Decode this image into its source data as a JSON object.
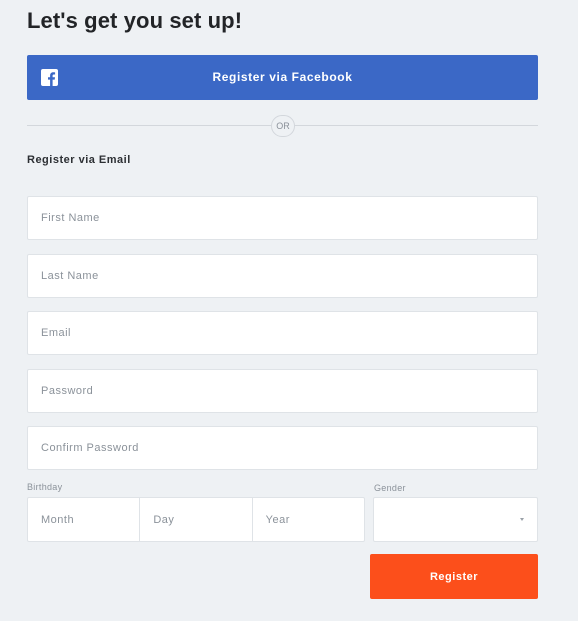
{
  "page": {
    "title": "Let's get you set up!"
  },
  "facebook": {
    "label": "Register via Facebook",
    "icon": "facebook-icon",
    "color": "#3b68c6"
  },
  "divider": {
    "label": "OR"
  },
  "email_section": {
    "heading": "Register via Email"
  },
  "form": {
    "first_name": {
      "value": "",
      "placeholder": "First Name"
    },
    "last_name": {
      "value": "",
      "placeholder": "Last Name"
    },
    "email": {
      "value": "",
      "placeholder": "Email"
    },
    "password": {
      "value": "",
      "placeholder": "Password"
    },
    "confirm_password": {
      "value": "",
      "placeholder": "Confirm Password"
    },
    "birthday": {
      "label": "Birthday",
      "month": {
        "value": "",
        "placeholder": "Month"
      },
      "day": {
        "value": "",
        "placeholder": "Day"
      },
      "year": {
        "value": "",
        "placeholder": "Year"
      }
    },
    "gender": {
      "label": "Gender",
      "selected": "",
      "icon": "caret-down-icon"
    }
  },
  "register": {
    "label": "Register",
    "color": "#fc4f1b"
  }
}
